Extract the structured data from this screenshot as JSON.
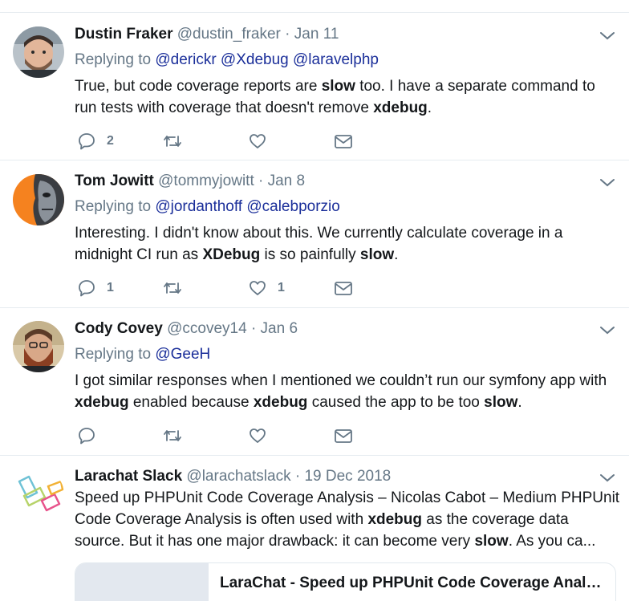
{
  "tweets": [
    {
      "name": "Dustin Fraker",
      "handle": "@dustin_fraker",
      "dot": "·",
      "time": "Jan 11",
      "replying_label": "Replying to",
      "mentions": [
        "@derickr",
        "@Xdebug",
        "@laravelphp"
      ],
      "body": [
        {
          "t": "True, but code coverage reports are ",
          "b": false
        },
        {
          "t": "slow",
          "b": true
        },
        {
          "t": " too. I have a separate command to run tests with coverage that doesn't remove ",
          "b": false
        },
        {
          "t": "xdebug",
          "b": true
        },
        {
          "t": ".",
          "b": false
        }
      ],
      "reply_count": "2",
      "retweet_count": "",
      "like_count": ""
    },
    {
      "name": "Tom Jowitt",
      "handle": "@tommyjowitt",
      "dot": "·",
      "time": "Jan 8",
      "replying_label": "Replying to",
      "mentions": [
        "@jordanthoff",
        "@calebporzio"
      ],
      "body": [
        {
          "t": "Interesting. I didn't know about this. We currently calculate coverage in a midnight CI run as ",
          "b": false
        },
        {
          "t": "XDebug",
          "b": true
        },
        {
          "t": " is so painfully ",
          "b": false
        },
        {
          "t": "slow",
          "b": true
        },
        {
          "t": ".",
          "b": false
        }
      ],
      "reply_count": "1",
      "retweet_count": "",
      "like_count": "1"
    },
    {
      "name": "Cody Covey",
      "handle": "@ccovey14",
      "dot": "·",
      "time": "Jan 6",
      "replying_label": "Replying to",
      "mentions": [
        "@GeeH"
      ],
      "body": [
        {
          "t": "I got similar responses when I mentioned we couldn’t run our symfony app with ",
          "b": false
        },
        {
          "t": "xdebug",
          "b": true
        },
        {
          "t": " enabled because ",
          "b": false
        },
        {
          "t": "xdebug",
          "b": true
        },
        {
          "t": " caused the app to be too ",
          "b": false
        },
        {
          "t": "slow",
          "b": true
        },
        {
          "t": ".",
          "b": false
        }
      ],
      "reply_count": "",
      "retweet_count": "",
      "like_count": ""
    },
    {
      "name": "Larachat Slack",
      "handle": "@larachatslack",
      "dot": "·",
      "time": "19 Dec 2018",
      "body": [
        {
          "t": "Speed up PHPUnit Code Coverage Analysis – Nicolas Cabot – Medium PHPUnit Code Coverage Analysis is often used with ",
          "b": false
        },
        {
          "t": "xdebug",
          "b": true
        },
        {
          "t": " as the coverage data source. But it has one major drawback: it can become very ",
          "b": false
        },
        {
          "t": "slow",
          "b": true
        },
        {
          "t": ". As you ca...",
          "b": false
        }
      ],
      "card_title": "LaraChat - Speed up PHPUnit Code Coverage Analysis – Nicolas Cabot – Medium"
    }
  ],
  "colors": {
    "text": "#14171a",
    "secondary": "#657786",
    "mention": "#1b2f9a",
    "divider": "#e6ecf0"
  },
  "icons": [
    "reply-icon",
    "retweet-icon",
    "like-icon",
    "message-icon",
    "chevron-down-icon"
  ]
}
